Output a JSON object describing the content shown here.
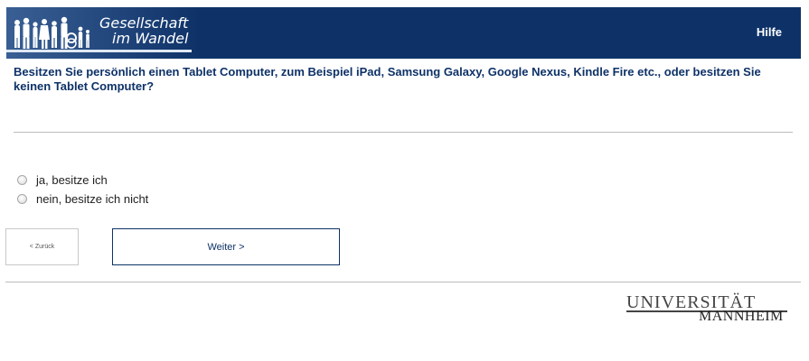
{
  "header": {
    "logo_line1": "Gesellschaft",
    "logo_line2": "im Wandel",
    "help_label": "Hilfe"
  },
  "question": {
    "text": "Besitzen Sie persönlich einen Tablet Computer, zum Beispiel iPad, Samsung Galaxy, Google Nexus, Kindle Fire etc., oder besitzen Sie keinen Tablet Computer?"
  },
  "options": [
    {
      "label": "ja, besitze ich",
      "selected": false
    },
    {
      "label": "nein, besitze ich nicht",
      "selected": false
    }
  ],
  "navigation": {
    "back_label": "< Zurück",
    "next_label": "Weiter >"
  },
  "footer": {
    "university_line1": "UNIVERSITÄT",
    "university_line2": "MANNHEIM"
  },
  "colors": {
    "brand_navy": "#0e3268",
    "divider": "#bdbdbd"
  },
  "icons": [
    "people-silhouettes-icon"
  ]
}
